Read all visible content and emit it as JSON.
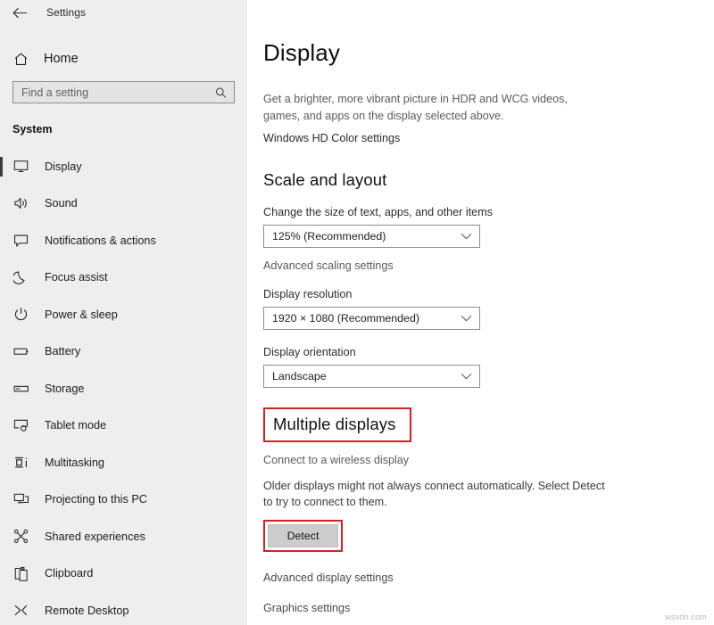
{
  "window": {
    "titlebar_label": "Settings",
    "back_icon": "back-arrow-icon"
  },
  "sidebar": {
    "home": {
      "label": "Home",
      "icon": "home-icon"
    },
    "search": {
      "placeholder": "Find a setting",
      "value": "",
      "icon": "search-icon"
    },
    "group_title": "System",
    "items": [
      {
        "label": "Display",
        "icon": "monitor-icon",
        "selected": true
      },
      {
        "label": "Sound",
        "icon": "speaker-icon",
        "selected": false
      },
      {
        "label": "Notifications & actions",
        "icon": "notification-icon",
        "selected": false
      },
      {
        "label": "Focus assist",
        "icon": "moon-icon",
        "selected": false
      },
      {
        "label": "Power & sleep",
        "icon": "power-icon",
        "selected": false
      },
      {
        "label": "Battery",
        "icon": "battery-icon",
        "selected": false
      },
      {
        "label": "Storage",
        "icon": "storage-icon",
        "selected": false
      },
      {
        "label": "Tablet mode",
        "icon": "tablet-icon",
        "selected": false
      },
      {
        "label": "Multitasking",
        "icon": "multitasking-icon",
        "selected": false
      },
      {
        "label": "Projecting to this PC",
        "icon": "projecting-icon",
        "selected": false
      },
      {
        "label": "Shared experiences",
        "icon": "share-nodes-icon",
        "selected": false
      },
      {
        "label": "Clipboard",
        "icon": "clipboard-icon",
        "selected": false
      },
      {
        "label": "Remote Desktop",
        "icon": "remote-desktop-icon",
        "selected": false
      }
    ]
  },
  "main": {
    "page_title": "Display",
    "hdr_desc": "Get a brighter, more vibrant picture in HDR and WCG videos, games, and apps on the display selected above.",
    "hd_color_link": "Windows HD Color settings",
    "scale_section": {
      "title": "Scale and layout",
      "scale_label": "Change the size of text, apps, and other items",
      "scale_value": "125% (Recommended)",
      "advanced_scaling_link": "Advanced scaling settings",
      "resolution_label": "Display resolution",
      "resolution_value": "1920 × 1080 (Recommended)",
      "orientation_label": "Display orientation",
      "orientation_value": "Landscape"
    },
    "multiple_displays": {
      "title": "Multiple displays",
      "wireless_link": "Connect to a wireless display",
      "detect_text": "Older displays might not always connect automatically. Select Detect to try to connect to them.",
      "detect_button": "Detect"
    },
    "advanced_display_link": "Advanced display settings",
    "graphics_settings_link": "Graphics settings"
  },
  "watermark": "wsxdn.com",
  "colors": {
    "highlight": "#d32020",
    "sidebar_bg": "#eeeeee",
    "button_bg": "#cccccc"
  }
}
